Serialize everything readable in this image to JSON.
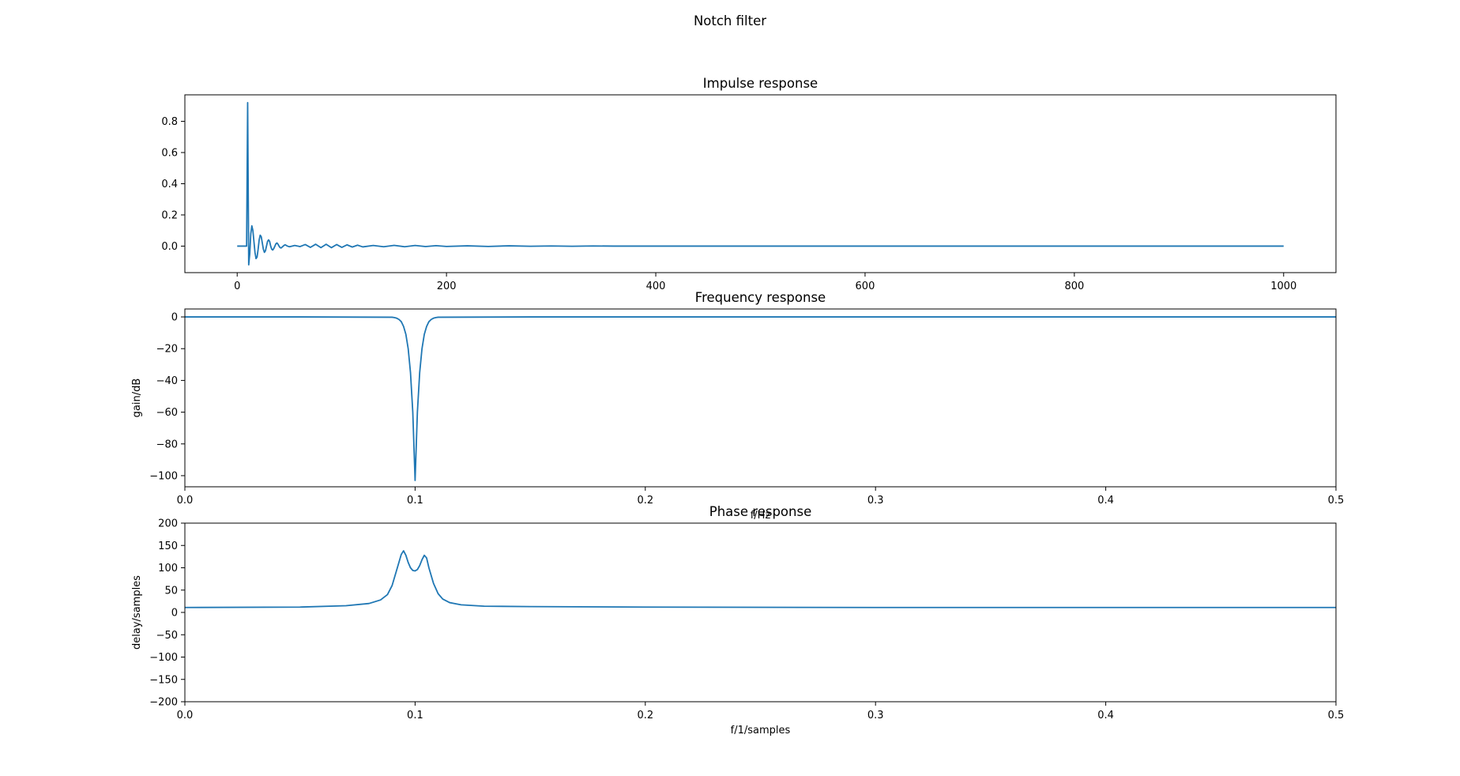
{
  "figure": {
    "suptitle": "Notch filter"
  },
  "chart_data": [
    {
      "type": "line",
      "title": "Impulse response",
      "xlabel": "",
      "ylabel": "",
      "xlim": [
        -50,
        1050
      ],
      "ylim": [
        -0.17,
        0.97
      ],
      "xticks": [
        0,
        200,
        400,
        600,
        800,
        1000
      ],
      "xtick_labels": [
        "0",
        "200",
        "400",
        "600",
        "800",
        "1000"
      ],
      "yticks": [
        0.0,
        0.2,
        0.4,
        0.6,
        0.8
      ],
      "ytick_labels": [
        "0.0",
        "0.2",
        "0.4",
        "0.6",
        "0.8"
      ],
      "grid": false,
      "color": "#1f77b4",
      "series": [
        {
          "x": [
            0,
            9,
            10,
            11,
            12,
            13,
            14,
            15,
            16,
            17,
            18,
            19,
            20,
            21,
            22,
            23,
            24,
            25,
            26,
            27,
            28,
            29,
            30,
            31,
            32,
            33,
            34,
            35,
            36,
            37,
            38,
            39,
            40,
            41,
            42,
            43,
            44,
            45,
            46,
            47,
            48,
            50,
            55,
            60,
            65,
            70,
            75,
            80,
            85,
            90,
            95,
            100,
            105,
            110,
            115,
            120,
            130,
            140,
            150,
            160,
            170,
            180,
            190,
            200,
            220,
            240,
            260,
            280,
            300,
            320,
            340,
            360,
            400,
            500,
            600,
            700,
            800,
            900,
            1000
          ],
          "y": [
            0.0,
            0.0,
            0.92,
            -0.12,
            -0.05,
            0.08,
            0.13,
            0.1,
            0.03,
            -0.04,
            -0.08,
            -0.07,
            -0.02,
            0.04,
            0.07,
            0.06,
            0.02,
            -0.02,
            -0.04,
            -0.03,
            0.0,
            0.03,
            0.04,
            0.03,
            0.0,
            -0.02,
            -0.025,
            -0.015,
            0.0,
            0.015,
            0.02,
            0.012,
            0.0,
            -0.01,
            -0.012,
            -0.006,
            0.0,
            0.006,
            0.008,
            0.004,
            0.0,
            -0.004,
            0.004,
            -0.003,
            0.01,
            -0.008,
            0.012,
            -0.01,
            0.012,
            -0.01,
            0.01,
            -0.008,
            0.008,
            -0.006,
            0.006,
            -0.005,
            0.004,
            -0.004,
            0.005,
            -0.004,
            0.004,
            -0.003,
            0.003,
            -0.002,
            0.002,
            -0.002,
            0.002,
            -0.001,
            0.001,
            -0.001,
            0.001,
            0.0,
            0.0,
            0.0,
            0.0,
            0.0,
            0.0,
            0.0,
            0.0
          ]
        }
      ]
    },
    {
      "type": "line",
      "title": "Frequency response",
      "xlabel": "f/Hz",
      "ylabel": "gain/dB",
      "xlim": [
        0,
        0.5
      ],
      "ylim": [
        -107,
        5
      ],
      "xticks": [
        0.0,
        0.1,
        0.2,
        0.3,
        0.4,
        0.5
      ],
      "xtick_labels": [
        "0.0",
        "0.1",
        "0.2",
        "0.3",
        "0.4",
        "0.5"
      ],
      "yticks": [
        0,
        -20,
        -40,
        -60,
        -80,
        -100
      ],
      "ytick_labels": [
        "0",
        "−20",
        "−40",
        "−60",
        "−80",
        "−100"
      ],
      "grid": false,
      "color": "#1f77b4",
      "series": [
        {
          "x": [
            0.0,
            0.05,
            0.09,
            0.091,
            0.092,
            0.093,
            0.094,
            0.095,
            0.096,
            0.097,
            0.098,
            0.099,
            0.1,
            0.101,
            0.102,
            0.103,
            0.104,
            0.105,
            0.106,
            0.107,
            0.108,
            0.109,
            0.11,
            0.15,
            0.3,
            0.5
          ],
          "y": [
            0.0,
            0.0,
            -0.2,
            -0.4,
            -0.8,
            -1.6,
            -3.0,
            -6.0,
            -11.0,
            -20.0,
            -35.0,
            -60.0,
            -103.0,
            -60.0,
            -35.0,
            -20.0,
            -11.0,
            -6.0,
            -3.0,
            -1.6,
            -0.8,
            -0.4,
            -0.2,
            0.0,
            0.0,
            0.0
          ]
        }
      ]
    },
    {
      "type": "line",
      "title": "Phase response",
      "xlabel": "f/1/samples",
      "ylabel": "delay/samples",
      "xlim": [
        0,
        0.5
      ],
      "ylim": [
        -200,
        200
      ],
      "xticks": [
        0.0,
        0.1,
        0.2,
        0.3,
        0.4,
        0.5
      ],
      "xtick_labels": [
        "0.0",
        "0.1",
        "0.2",
        "0.3",
        "0.4",
        "0.5"
      ],
      "yticks": [
        200,
        150,
        100,
        50,
        0,
        -50,
        -100,
        -150,
        -200
      ],
      "ytick_labels": [
        "200",
        "150",
        "100",
        "50",
        "0",
        "−50",
        "−100",
        "−150",
        "−200"
      ],
      "grid": false,
      "color": "#1f77b4",
      "series": [
        {
          "x": [
            0.0,
            0.05,
            0.07,
            0.08,
            0.085,
            0.088,
            0.09,
            0.092,
            0.094,
            0.095,
            0.096,
            0.097,
            0.098,
            0.099,
            0.1,
            0.101,
            0.102,
            0.103,
            0.104,
            0.105,
            0.106,
            0.108,
            0.11,
            0.112,
            0.115,
            0.12,
            0.13,
            0.15,
            0.2,
            0.3,
            0.4,
            0.5
          ],
          "y": [
            11.0,
            12.0,
            15.0,
            20.0,
            28.0,
            40.0,
            60.0,
            95.0,
            130.0,
            138.0,
            128.0,
            112.0,
            100.0,
            94.0,
            93.0,
            96.0,
            105.0,
            118.0,
            128.0,
            122.0,
            100.0,
            65.0,
            42.0,
            30.0,
            22.0,
            17.0,
            14.0,
            13.0,
            12.0,
            11.0,
            11.0,
            11.0
          ]
        }
      ]
    }
  ]
}
